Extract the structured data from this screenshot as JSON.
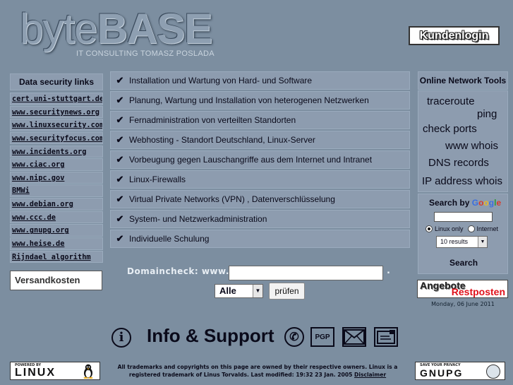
{
  "header": {
    "logo_light": "byte",
    "logo_bold": "BASE",
    "logo_sub": "IT CONSULTING TOMASZ POSLADA",
    "kundenlogin_label": "Kundenlogin"
  },
  "security_links": {
    "title": "Data security links",
    "items": [
      "cert.uni-stuttgart.de",
      "www.securitynews.org",
      "www.linuxsecurity.com",
      "www.securityfocus.com",
      "www.incidents.org",
      "www.ciac.org",
      "www.nipc.gov",
      "BMWi",
      "www.debian.org",
      "www.ccc.de",
      "www.gnupg.org",
      "www.heise.de",
      "Rijndael algorithm"
    ],
    "versandkosten": "Versandkosten"
  },
  "services": [
    "Installation und Wartung von Hard- und Software",
    "Planung, Wartung und Installation von heterogenen Netzwerken",
    "Fernadministration von verteilten Standorten",
    "Webhosting - Standort Deutschland, Linux-Server",
    "Vorbeugung gegen Lauschangriffe aus dem Internet und Intranet",
    "Linux-Firewalls",
    "Virtual Private Networks (VPN) , Datenverschlüsselung",
    "System- und Netzwerkadministration",
    "Individuelle Schulung"
  ],
  "domaincheck": {
    "label": "Domaincheck:  www.",
    "value": "",
    "dot": ".",
    "select_value": "Alle",
    "button_label": "prüfen"
  },
  "network_tools": {
    "title": "Online Network Tools",
    "items": [
      "traceroute",
      "ping",
      "check ports",
      "www whois",
      "DNS records",
      "IP address whois"
    ]
  },
  "search": {
    "title_prefix": "Search by",
    "google_letters": [
      "G",
      "o",
      "o",
      "g",
      "l",
      "e"
    ],
    "input_value": "",
    "radio_linux": "Linux only",
    "radio_internet": "Internet",
    "results_value": "10 results",
    "button_label": "Search"
  },
  "angebote": {
    "top": "Angebote",
    "bottom": "Restposten"
  },
  "date": "Monday, 06 June 2011",
  "info": {
    "title": "Info & Support",
    "pgp_label": "PGP"
  },
  "footer": {
    "linux_small": "POWERED BY",
    "linux_big": "LINUX",
    "line1": "All trademarks and copyrights on this page are owned by their respective owners. Linux is a",
    "line2": "registered trademark of Linus Torvalds.  Last modified:  19:32 23 Jan. 2005 ",
    "disclaimer": "Disclaimer",
    "gnupg_small": "SAVE YOUR PRIVACY",
    "gnupg_big": "GNUPG"
  }
}
